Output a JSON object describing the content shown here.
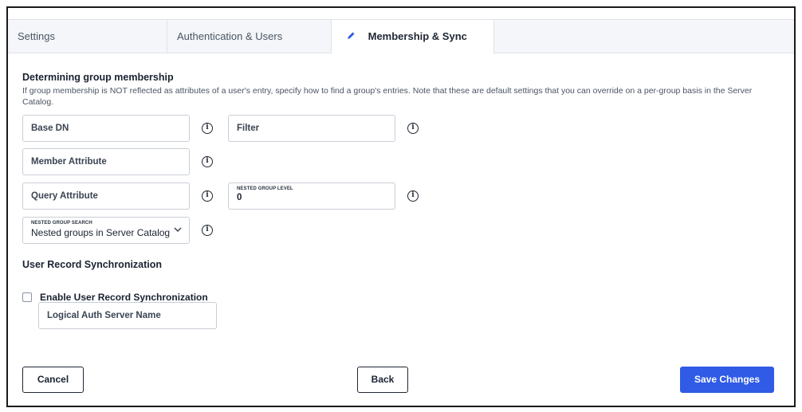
{
  "tabs": [
    {
      "label": "Settings",
      "active": false
    },
    {
      "label": "Authentication & Users",
      "active": false
    },
    {
      "label": "Membership & Sync",
      "active": true,
      "icon": "pencil-icon"
    }
  ],
  "membership": {
    "title": "Determining group membership",
    "description": "If group membership is NOT reflected as attributes of a user's entry, specify how to find a group's entries. Note that these are default settings that you can override on a per-group basis in the Server Catalog.",
    "base_dn_placeholder": "Base DN",
    "filter_placeholder": "Filter",
    "member_attribute_placeholder": "Member Attribute",
    "query_attribute_placeholder": "Query Attribute",
    "nested_group_level": {
      "label": "NESTED GROUP LEVEL",
      "value": "0"
    },
    "nested_group_search": {
      "label": "NESTED GROUP SEARCH",
      "value": "Nested groups in Server Catalog"
    }
  },
  "sync": {
    "title": "User Record Synchronization",
    "enable_label": "Enable User Record Synchronization",
    "enabled": false,
    "logical_server_placeholder": "Logical Auth Server Name"
  },
  "buttons": {
    "cancel": "Cancel",
    "back": "Back",
    "save": "Save Changes"
  },
  "colors": {
    "primary": "#2f5be6",
    "tab_bar": "#f4f6f9",
    "border": "#c8ced6"
  },
  "info_glyph": "i"
}
